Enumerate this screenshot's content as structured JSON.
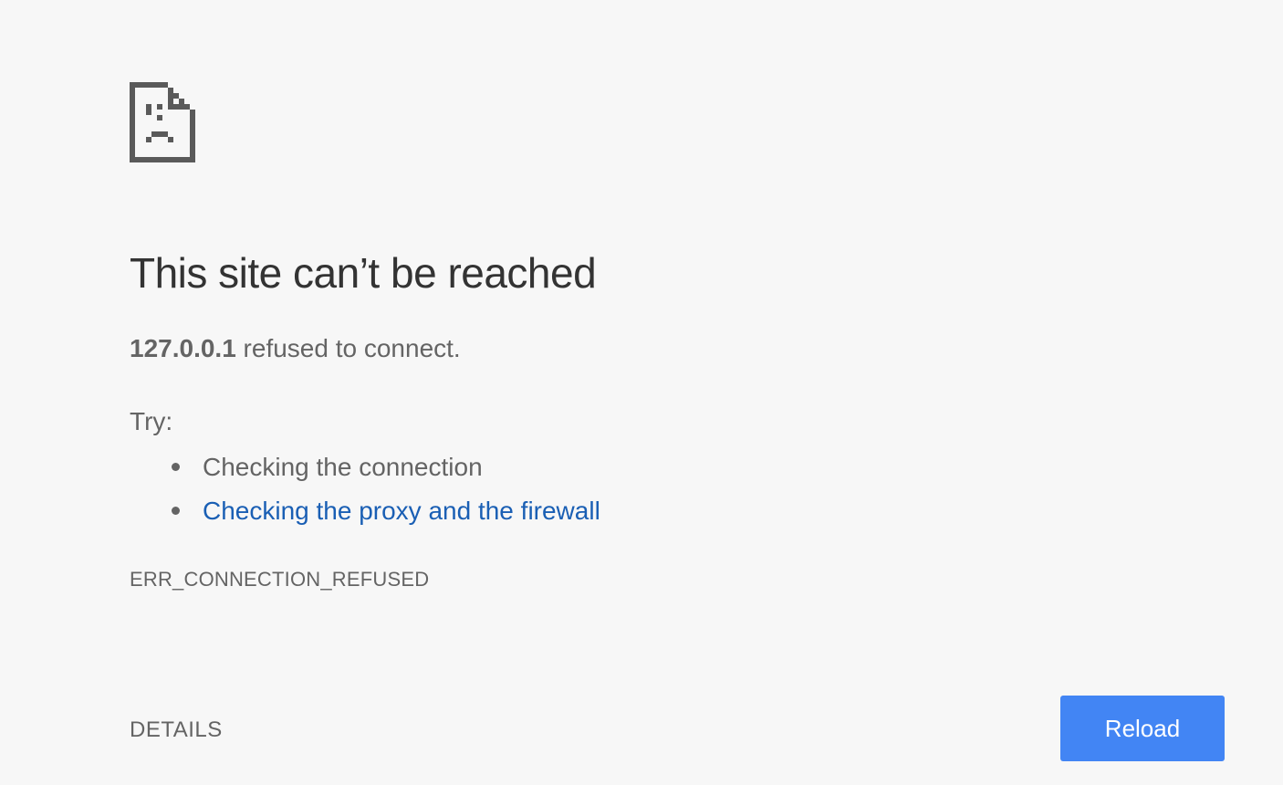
{
  "error_page": {
    "icon": "sad-page-icon",
    "title": "This site can’t be reached",
    "summary": {
      "host": "127.0.0.1",
      "message": " refused to connect."
    },
    "try_label": "Try:",
    "suggestions": [
      {
        "text": "Checking the connection",
        "is_link": false
      },
      {
        "text": "Checking the proxy and the firewall",
        "is_link": true
      }
    ],
    "error_code": "ERR_CONNECTION_REFUSED",
    "details_label": "DETAILS",
    "reload_label": "Reload"
  },
  "colors": {
    "background": "#f7f7f7",
    "heading": "#333333",
    "body_text": "#646464",
    "link": "#1a5fb4",
    "reload_button": "#4285f4",
    "reload_text": "#ffffff",
    "icon": "#5a5a5a"
  }
}
